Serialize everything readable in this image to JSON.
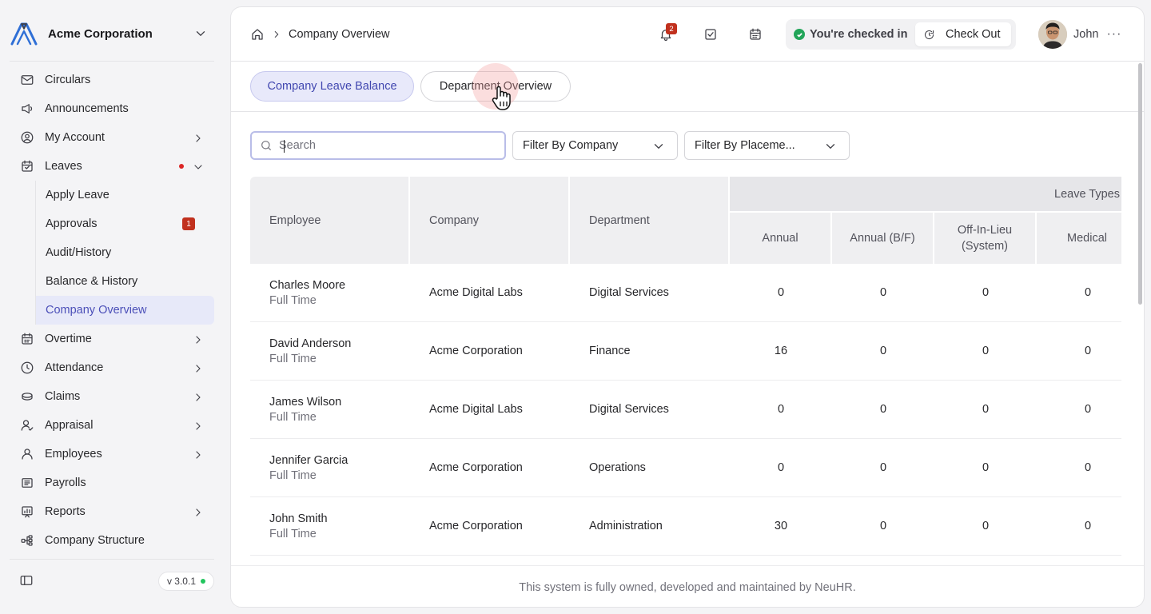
{
  "brand": {
    "name": "Acme Corporation"
  },
  "sidebar": {
    "items": [
      {
        "label": "Circulars"
      },
      {
        "label": "Announcements"
      },
      {
        "label": "My Account"
      },
      {
        "label": "Leaves"
      },
      {
        "label": "Overtime"
      },
      {
        "label": "Attendance"
      },
      {
        "label": "Claims"
      },
      {
        "label": "Appraisal"
      },
      {
        "label": "Employees"
      },
      {
        "label": "Payrolls"
      },
      {
        "label": "Reports"
      },
      {
        "label": "Company Structure"
      }
    ],
    "leaves_sub": [
      {
        "label": "Apply Leave"
      },
      {
        "label": "Approvals",
        "badge": "1"
      },
      {
        "label": "Audit/History"
      },
      {
        "label": "Balance & History"
      },
      {
        "label": "Company Overview"
      }
    ],
    "version": "v 3.0.1"
  },
  "topbar": {
    "breadcrumb": "Company Overview",
    "notification_count": "2",
    "checkin_status": "You're checked in",
    "checkout_label": "Check Out",
    "user_name": "John",
    "more": "···"
  },
  "tabs": [
    {
      "label": "Company Leave Balance"
    },
    {
      "label": "Department Overview"
    }
  ],
  "filters": {
    "search_placeholder": "Search",
    "company_filter": "Filter By Company",
    "placement_filter": "Filter By Placeme..."
  },
  "table": {
    "headers": {
      "employee": "Employee",
      "company": "Company",
      "department": "Department",
      "group": "Leave Types",
      "leave_types": [
        "Annual",
        "Annual (B/F)",
        "Off-In-Lieu (System)",
        "Medical"
      ]
    },
    "rows": [
      {
        "name": "Charles Moore",
        "type": "Full Time",
        "company": "Acme Digital Labs",
        "department": "Digital Services",
        "values": [
          "0",
          "0",
          "0",
          "0"
        ]
      },
      {
        "name": "David Anderson",
        "type": "Full Time",
        "company": "Acme Corporation",
        "department": "Finance",
        "values": [
          "16",
          "0",
          "0",
          "0"
        ]
      },
      {
        "name": "James Wilson",
        "type": "Full Time",
        "company": "Acme Digital Labs",
        "department": "Digital Services",
        "values": [
          "0",
          "0",
          "0",
          "0"
        ]
      },
      {
        "name": "Jennifer Garcia",
        "type": "Full Time",
        "company": "Acme Corporation",
        "department": "Operations",
        "values": [
          "0",
          "0",
          "0",
          "0"
        ]
      },
      {
        "name": "John Smith",
        "type": "Full Time",
        "company": "Acme Corporation",
        "department": "Administration",
        "values": [
          "30",
          "0",
          "0",
          "0"
        ]
      }
    ]
  },
  "footer": {
    "text": "This system is fully owned, developed and maintained by NeuHR."
  }
}
